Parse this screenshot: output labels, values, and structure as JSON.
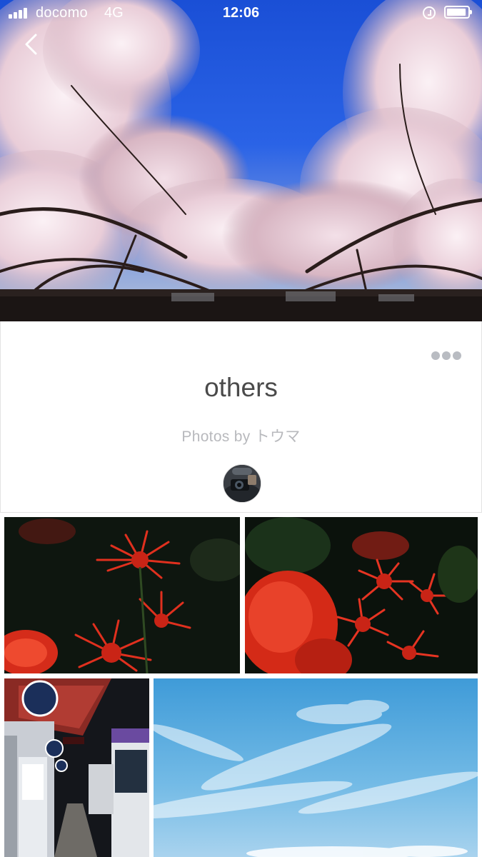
{
  "status_bar": {
    "carrier": "docomo",
    "network": "4G",
    "time": "12:06"
  },
  "album": {
    "title": "others",
    "byline": "Photos by トウマ"
  },
  "icons": {
    "back": "chevron-left-icon",
    "more": "more-horizontal-icon",
    "lock": "orientation-lock-icon",
    "battery": "battery-icon",
    "signal": "signal-bars-icon"
  },
  "colors": {
    "title_text": "#4a4a4a",
    "byline_text": "#b8b9bd",
    "more_dots": "#b9bcc2",
    "card_border": "#e3e3e3"
  },
  "photos": [
    {
      "subject": "red spider lilies"
    },
    {
      "subject": "red spider lilies"
    },
    {
      "subject": "bus terminal"
    },
    {
      "subject": "blue sky"
    }
  ]
}
